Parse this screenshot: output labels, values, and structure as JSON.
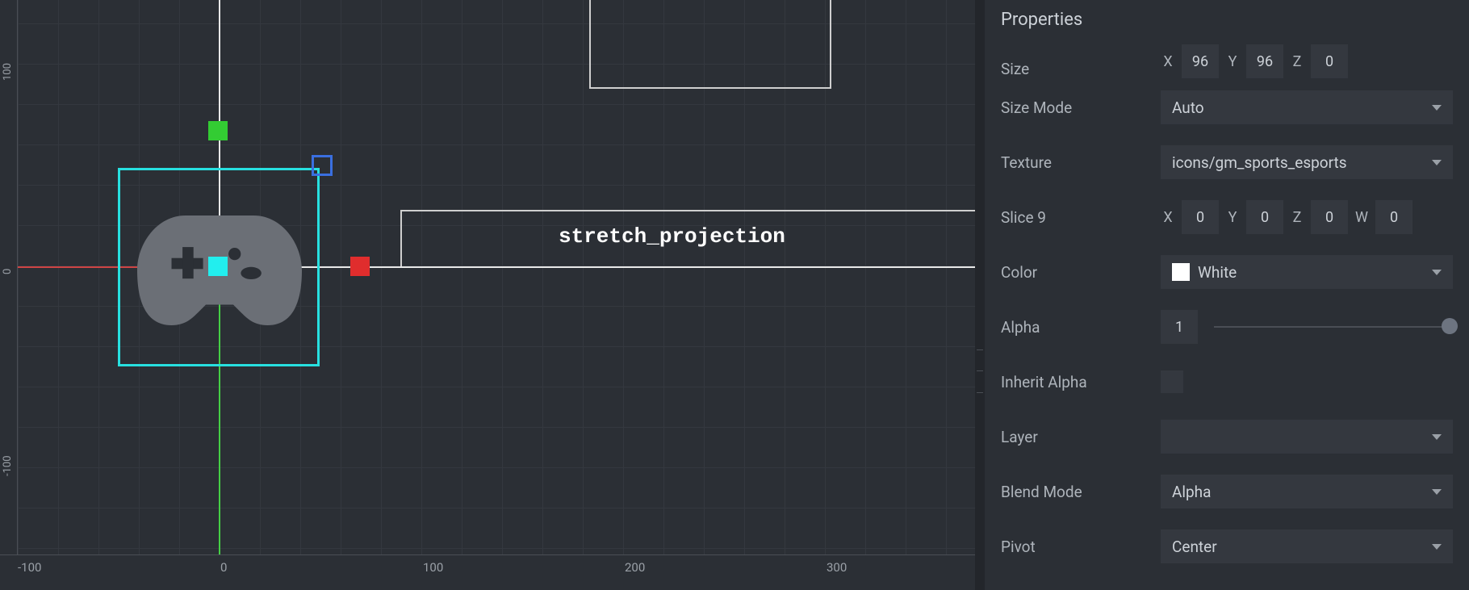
{
  "canvas": {
    "node_label": "stretch_projection",
    "ruler_x": [
      "-100",
      "0",
      "100",
      "200",
      "300"
    ],
    "ruler_y": [
      "100",
      "0",
      "-100"
    ]
  },
  "panel": {
    "title": "Properties",
    "size_cut": {
      "label": "Size",
      "x_label": "X",
      "x": "96",
      "y_label": "Y",
      "y": "96",
      "z_label": "Z",
      "z": "0"
    },
    "size_mode": {
      "label": "Size Mode",
      "value": "Auto"
    },
    "texture": {
      "label": "Texture",
      "value": "icons/gm_sports_esports"
    },
    "slice9": {
      "label": "Slice 9",
      "x_label": "X",
      "x": "0",
      "y_label": "Y",
      "y": "0",
      "z_label": "Z",
      "z": "0",
      "w_label": "W",
      "w": "0"
    },
    "color": {
      "label": "Color",
      "value": "White"
    },
    "alpha": {
      "label": "Alpha",
      "value": "1"
    },
    "inherit_alpha": {
      "label": "Inherit Alpha"
    },
    "layer": {
      "label": "Layer",
      "value": ""
    },
    "blend": {
      "label": "Blend Mode",
      "value": "Alpha"
    },
    "pivot": {
      "label": "Pivot",
      "value": "Center"
    }
  }
}
